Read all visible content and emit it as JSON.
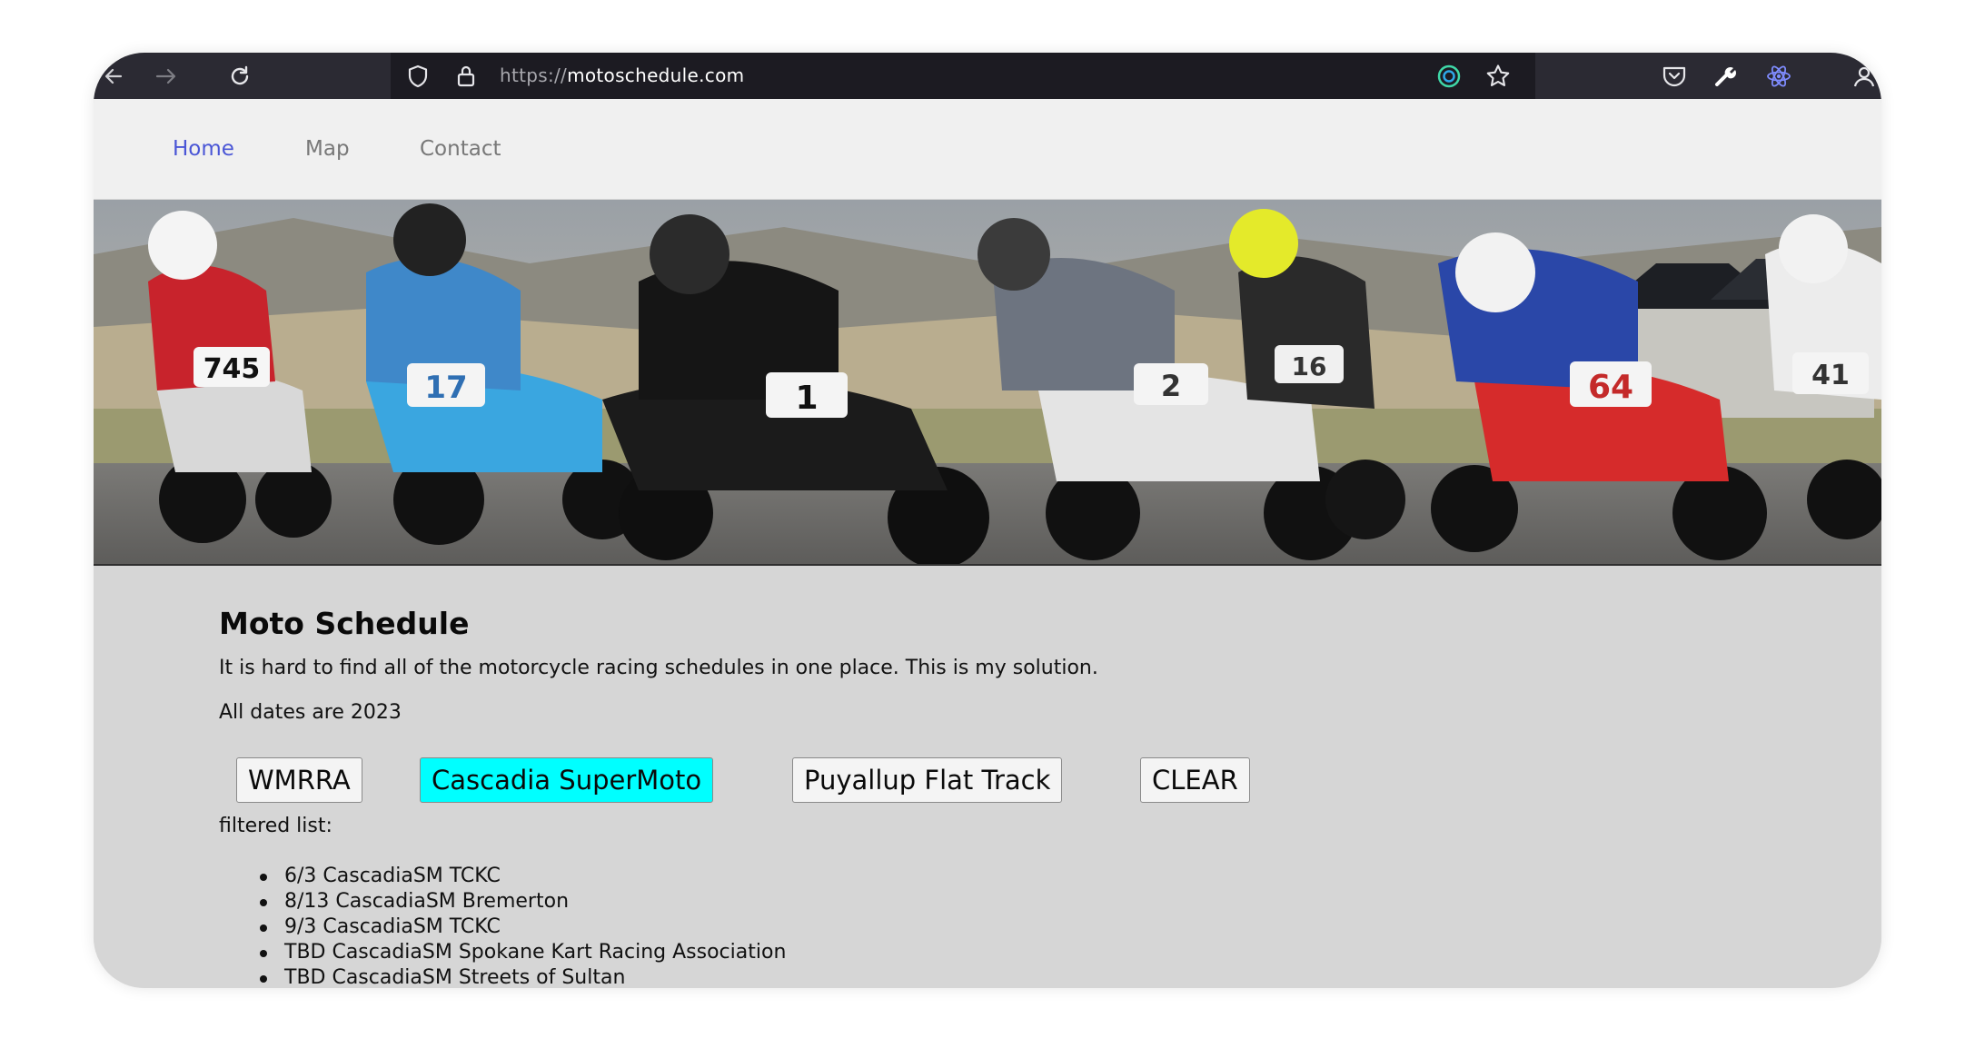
{
  "browser": {
    "url_scheme": "https://",
    "url_host": "motoschedule.com",
    "icons": [
      "back-arrow-icon",
      "forward-arrow-icon",
      "reload-icon",
      "shield-icon",
      "lock-icon",
      "extension-circle-icon",
      "star-icon",
      "pocket-icon",
      "wrench-icon",
      "react-devtools-icon",
      "account-icon"
    ]
  },
  "nav": {
    "items": [
      {
        "label": "Home",
        "active": true
      },
      {
        "label": "Map",
        "active": false
      },
      {
        "label": "Contact",
        "active": false
      }
    ],
    "active_color": "#4a56d6"
  },
  "hero": {
    "rider_numbers": [
      "745",
      "17",
      "1",
      "2",
      "16",
      "64",
      "41"
    ]
  },
  "main": {
    "title": "Moto Schedule",
    "intro": "It is hard to find all of the motorcycle racing schedules in one place. This is my solution.",
    "year_note": "All dates are 2023",
    "filters": [
      {
        "label": "WMRRA",
        "selected": false
      },
      {
        "label": "Cascadia SuperMoto",
        "selected": true
      },
      {
        "label": "Puyallup Flat Track",
        "selected": false
      },
      {
        "label": "CLEAR",
        "selected": false
      }
    ],
    "selected_color": "#00ffff",
    "filtered_label": "filtered list:",
    "events": [
      "6/3 CascadiaSM TCKC",
      "8/13 CascadiaSM Bremerton",
      "9/3 CascadiaSM TCKC",
      "TBD CascadiaSM Spokane Kart Racing Association",
      "TBD CascadiaSM Streets of Sultan"
    ]
  }
}
